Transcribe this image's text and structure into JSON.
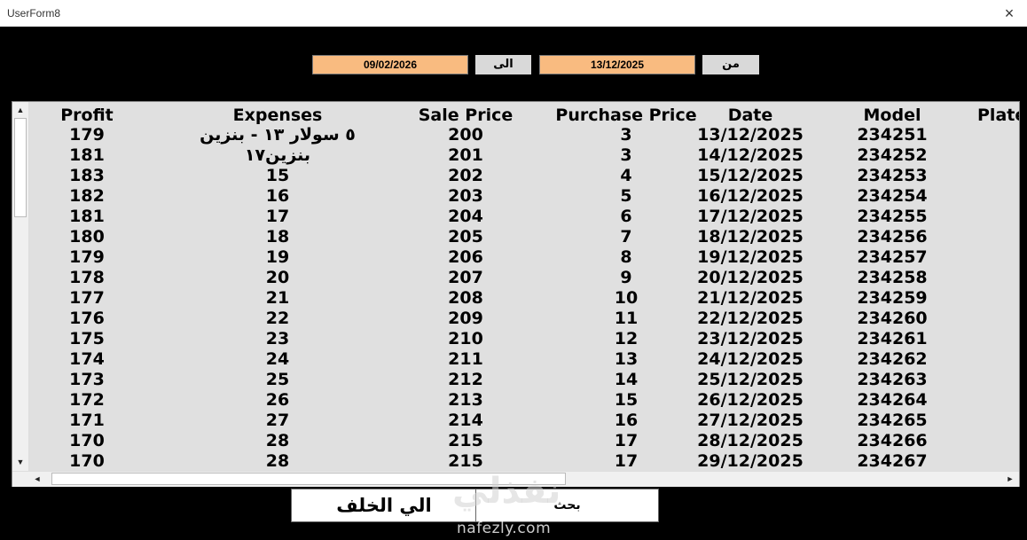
{
  "window": {
    "title": "UserForm8",
    "close_icon": "×"
  },
  "date_filter": {
    "from_label": "من",
    "from_date": "13/12/2025",
    "to_label": "الى",
    "to_date": "09/02/2026",
    "field_color": "#f9bb80"
  },
  "table": {
    "headers": {
      "profit": "Profit",
      "expenses": "Expenses",
      "sale_price": "Sale Price",
      "purchase_price": "Purchase Price",
      "date": "Date",
      "model": "Model",
      "plate": "Plate"
    },
    "rows": [
      {
        "profit": "179",
        "expenses": "٥ سولار ١٣ - بنزين",
        "sale_price": "200",
        "purchase_price": "3",
        "date": "13/12/2025",
        "model": "234251"
      },
      {
        "profit": "181",
        "expenses": "بنزين١٧",
        "sale_price": "201",
        "purchase_price": "3",
        "date": "14/12/2025",
        "model": "234252"
      },
      {
        "profit": "183",
        "expenses": "15",
        "sale_price": "202",
        "purchase_price": "4",
        "date": "15/12/2025",
        "model": "234253"
      },
      {
        "profit": "182",
        "expenses": "16",
        "sale_price": "203",
        "purchase_price": "5",
        "date": "16/12/2025",
        "model": "234254"
      },
      {
        "profit": "181",
        "expenses": "17",
        "sale_price": "204",
        "purchase_price": "6",
        "date": "17/12/2025",
        "model": "234255"
      },
      {
        "profit": "180",
        "expenses": "18",
        "sale_price": "205",
        "purchase_price": "7",
        "date": "18/12/2025",
        "model": "234256"
      },
      {
        "profit": "179",
        "expenses": "19",
        "sale_price": "206",
        "purchase_price": "8",
        "date": "19/12/2025",
        "model": "234257"
      },
      {
        "profit": "178",
        "expenses": "20",
        "sale_price": "207",
        "purchase_price": "9",
        "date": "20/12/2025",
        "model": "234258"
      },
      {
        "profit": "177",
        "expenses": "21",
        "sale_price": "208",
        "purchase_price": "10",
        "date": "21/12/2025",
        "model": "234259"
      },
      {
        "profit": "176",
        "expenses": "22",
        "sale_price": "209",
        "purchase_price": "11",
        "date": "22/12/2025",
        "model": "234260"
      },
      {
        "profit": "175",
        "expenses": "23",
        "sale_price": "210",
        "purchase_price": "12",
        "date": "23/12/2025",
        "model": "234261"
      },
      {
        "profit": "174",
        "expenses": "24",
        "sale_price": "211",
        "purchase_price": "13",
        "date": "24/12/2025",
        "model": "234262"
      },
      {
        "profit": "173",
        "expenses": "25",
        "sale_price": "212",
        "purchase_price": "14",
        "date": "25/12/2025",
        "model": "234263"
      },
      {
        "profit": "172",
        "expenses": "26",
        "sale_price": "213",
        "purchase_price": "15",
        "date": "26/12/2025",
        "model": "234264"
      },
      {
        "profit": "171",
        "expenses": "27",
        "sale_price": "214",
        "purchase_price": "16",
        "date": "27/12/2025",
        "model": "234265"
      },
      {
        "profit": "170",
        "expenses": "28",
        "sale_price": "215",
        "purchase_price": "17",
        "date": "28/12/2025",
        "model": "234266"
      },
      {
        "profit": "170",
        "expenses": "28",
        "sale_price": "215",
        "purchase_price": "17",
        "date": "29/12/2025",
        "model": "234267"
      }
    ]
  },
  "scroll": {
    "up_icon": "▲",
    "down_icon": "▼",
    "left_icon": "◄",
    "right_icon": "►"
  },
  "buttons": {
    "back_label": "الي الخلف",
    "search_label": "بحث"
  },
  "watermark": {
    "logo_text": "نفذلي",
    "url": "nafezly.com"
  }
}
